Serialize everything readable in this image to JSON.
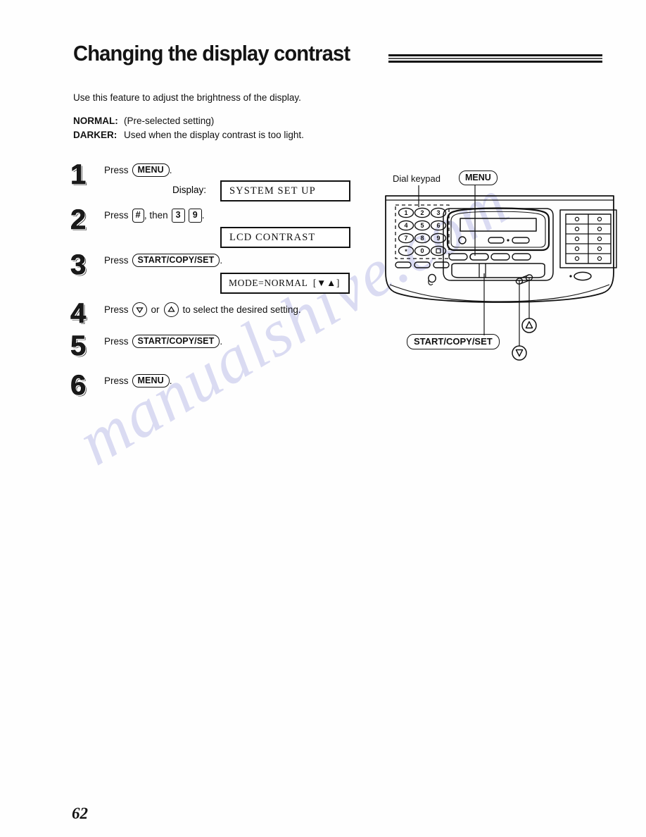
{
  "document": {
    "title": "Changing the display contrast",
    "intro": "Use this feature to adjust the brightness of the display.",
    "page_number": "62",
    "watermark": "manualshive.com",
    "watermark_color": "#cfd0ef"
  },
  "settings": {
    "normal_label": "NORMAL:",
    "normal_desc": "(Pre-selected setting)",
    "darker_label": "DARKER:",
    "darker_desc": "Used when the display contrast is too light."
  },
  "steps": [
    {
      "number": "1",
      "words": [
        "Press",
        "."
      ],
      "keys": [
        "MENU"
      ]
    },
    {
      "number": "2",
      "words": [
        "Press",
        ", then",
        "",
        "."
      ],
      "keys": [
        "#",
        "3",
        "9"
      ]
    },
    {
      "number": "3",
      "words": [
        "Press",
        "."
      ],
      "keys": [
        "START/COPY/SET"
      ]
    },
    {
      "number": "4",
      "words": [
        "Press",
        "or",
        "to select the desired setting."
      ],
      "keys": [
        "down-arrow",
        "up-arrow"
      ]
    },
    {
      "number": "5",
      "words": [
        "Press",
        "."
      ],
      "keys": [
        "START/COPY/SET"
      ]
    },
    {
      "number": "6",
      "words": [
        "Press",
        "."
      ],
      "keys": [
        "MENU"
      ]
    }
  ],
  "step_text": {
    "press": "Press",
    "then": ", then",
    "period": ".",
    "or": "or",
    "select_setting": "to select the desired setting.",
    "comma_period": "."
  },
  "keys": {
    "menu": "MENU",
    "start_copy_set": "START/COPY/SET",
    "hash": "#",
    "three": "3",
    "nine": "9"
  },
  "display": {
    "label": "Display:",
    "screen_1": "SYSTEM SET UP",
    "screen_2": "LCD CONTRAST",
    "screen_3": "MODE=NORMAL  [▼▲]"
  },
  "diagram": {
    "labels": {
      "dial_keypad": "Dial keypad",
      "menu": "MENU",
      "start_copy_set": "START/COPY/SET"
    },
    "keypad_rows": [
      [
        "1",
        "2",
        "3"
      ],
      [
        "4",
        "5",
        "6"
      ],
      [
        "7",
        "8",
        "9"
      ],
      [
        "*",
        "0",
        "#"
      ]
    ],
    "one_touch_rows": 5,
    "one_touch_cols": 2
  }
}
